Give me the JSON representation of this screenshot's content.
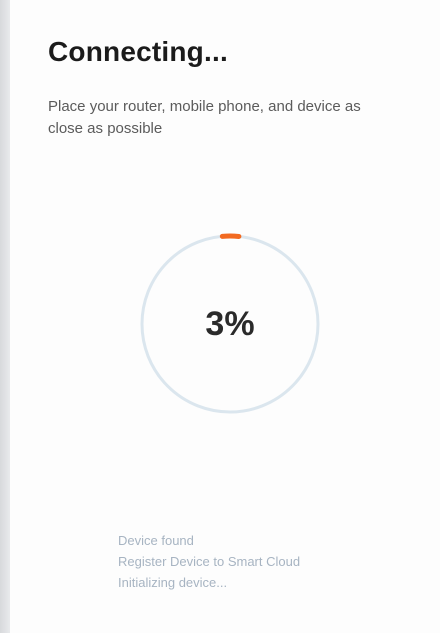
{
  "header": {
    "title": "Connecting...",
    "subtitle": "Place your router, mobile phone, and device as close as possible"
  },
  "progress": {
    "value": 0.03,
    "label": "3%",
    "track_color": "#dbe6ee",
    "fill_color": "#f26a21"
  },
  "status": {
    "items": [
      "Device found",
      "Register Device to Smart Cloud",
      "Initializing device..."
    ]
  }
}
